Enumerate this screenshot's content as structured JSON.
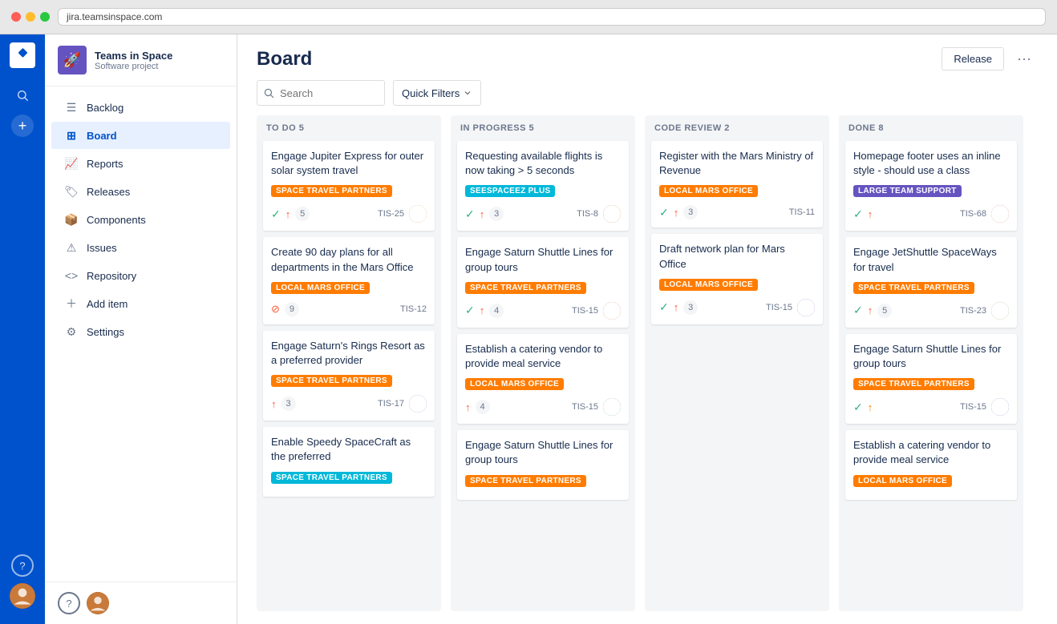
{
  "browser": {
    "url": "jira.teamsinspace.com"
  },
  "app": {
    "logo_text": "◆",
    "project": {
      "name": "Teams in Space",
      "type": "Software project",
      "emoji": "🚀"
    },
    "nav": [
      {
        "id": "backlog",
        "label": "Backlog",
        "icon": "☰",
        "active": false
      },
      {
        "id": "board",
        "label": "Board",
        "icon": "⊞",
        "active": true
      },
      {
        "id": "reports",
        "label": "Reports",
        "icon": "📈",
        "active": false
      },
      {
        "id": "releases",
        "label": "Releases",
        "icon": "🏷",
        "active": false
      },
      {
        "id": "components",
        "label": "Components",
        "icon": "📦",
        "active": false
      },
      {
        "id": "issues",
        "label": "Issues",
        "icon": "⚠",
        "active": false
      },
      {
        "id": "repository",
        "label": "Repository",
        "icon": "⟨⟩",
        "active": false
      },
      {
        "id": "add-item",
        "label": "Add item",
        "icon": "＋",
        "active": false
      },
      {
        "id": "settings",
        "label": "Settings",
        "icon": "⚙",
        "active": false
      }
    ],
    "page_title": "Board",
    "header_actions": {
      "release_label": "Release",
      "more_label": "···"
    },
    "toolbar": {
      "search_placeholder": "Search",
      "quick_filters_label": "Quick Filters"
    },
    "columns": [
      {
        "id": "todo",
        "header": "TO DO 5",
        "cards": [
          {
            "title": "Engage Jupiter Express for outer solar system travel",
            "tag": "SPACE TRAVEL PARTNERS",
            "tag_color": "tag-orange",
            "check": true,
            "arrow": "up",
            "points": "5",
            "id": "TIS-25",
            "avatar": "av1"
          },
          {
            "title": "Create 90 day plans for all departments in the Mars Office",
            "tag": "LOCAL MARS OFFICE",
            "tag_color": "tag-orange",
            "check": false,
            "block": true,
            "points": "9",
            "id": "TIS-12",
            "avatar": null
          },
          {
            "title": "Engage Saturn's Rings Resort as a preferred provider",
            "tag": "SPACE TRAVEL PARTNERS",
            "tag_color": "tag-orange",
            "check": false,
            "arrow": "up",
            "points": "3",
            "id": "TIS-17",
            "avatar": "av2"
          },
          {
            "title": "Enable Speedy SpaceCraft as the preferred",
            "tag": "SPACE TRAVEL PARTNERS",
            "tag_color": "tag-teal",
            "check": false,
            "arrow": null,
            "points": null,
            "id": null,
            "avatar": null,
            "partial": true
          }
        ]
      },
      {
        "id": "inprogress",
        "header": "IN PROGRESS 5",
        "cards": [
          {
            "title": "Requesting available flights is now taking > 5 seconds",
            "tag": "SEESPACEEZ PLUS",
            "tag_color": "tag-teal",
            "check": true,
            "arrow": "up",
            "points": "3",
            "id": "TIS-8",
            "avatar": "av3"
          },
          {
            "title": "Engage Saturn Shuttle Lines for group tours",
            "tag": "SPACE TRAVEL PARTNERS",
            "tag_color": "tag-orange",
            "check": true,
            "arrow": "up",
            "points": "4",
            "id": "TIS-15",
            "avatar": "av4"
          },
          {
            "title": "Establish a catering vendor to provide meal service",
            "tag": "LOCAL MARS OFFICE",
            "tag_color": "tag-orange",
            "check": false,
            "arrow": "up",
            "points": "4",
            "id": "TIS-15",
            "avatar": "av5"
          },
          {
            "title": "Engage Saturn Shuttle Lines for group tours",
            "tag": "SPACE TRAVEL PARTNERS",
            "tag_color": "tag-orange",
            "check": false,
            "arrow": null,
            "points": null,
            "id": null,
            "avatar": null,
            "partial": true
          }
        ]
      },
      {
        "id": "codereview",
        "header": "CODE REVIEW 2",
        "cards": [
          {
            "title": "Register with the Mars Ministry of Revenue",
            "tag": "LOCAL MARS OFFICE",
            "tag_color": "tag-orange",
            "check": true,
            "arrow": "up",
            "points": "3",
            "id": "TIS-11",
            "avatar": null
          },
          {
            "title": "Draft network plan for Mars Office",
            "tag": "LOCAL MARS OFFICE",
            "tag_color": "tag-orange",
            "check": true,
            "arrow": "up",
            "points": "3",
            "id": "TIS-15",
            "avatar": "av6"
          }
        ]
      },
      {
        "id": "done",
        "header": "DONE 8",
        "cards": [
          {
            "title": "Homepage footer uses an inline style - should use a class",
            "tag": "LARGE TEAM SUPPORT",
            "tag_color": "tag-purple",
            "check": true,
            "arrow": "up",
            "points": null,
            "id": "TIS-68",
            "avatar": "av7"
          },
          {
            "title": "Engage JetShuttle SpaceWays for travel",
            "tag": "SPACE TRAVEL PARTNERS",
            "tag_color": "tag-orange",
            "check": true,
            "arrow": "up",
            "points": "5",
            "id": "TIS-23",
            "avatar": "av8"
          },
          {
            "title": "Engage Saturn Shuttle Lines for group tours",
            "tag": "SPACE TRAVEL PARTNERS",
            "tag_color": "tag-orange",
            "check": true,
            "arrow_orange": true,
            "points": null,
            "id": "TIS-15",
            "avatar": "av9"
          },
          {
            "title": "Establish a catering vendor to provide meal service",
            "tag": "LOCAL MARS OFFICE",
            "tag_color": "tag-orange",
            "check": false,
            "arrow": null,
            "points": null,
            "id": null,
            "avatar": null,
            "partial": true
          }
        ]
      }
    ]
  }
}
